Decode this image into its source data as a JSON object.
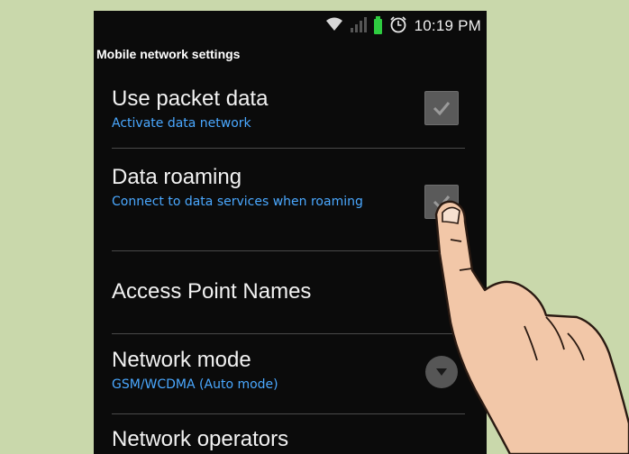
{
  "status_bar": {
    "time": "10:19 PM",
    "icons": [
      "wifi-icon",
      "signal-icon",
      "battery-icon",
      "alarm-icon"
    ]
  },
  "screen": {
    "title": "Mobile network settings",
    "items": [
      {
        "title": "Use packet data",
        "subtitle": "Activate data network",
        "control": "checkbox",
        "checked": true
      },
      {
        "title": "Data roaming",
        "subtitle": "Connect to data services when roaming",
        "control": "checkbox",
        "checked": true
      },
      {
        "title": "Access Point Names"
      },
      {
        "title": "Network mode",
        "subtitle": "GSM/WCDMA (Auto mode)",
        "control": "dropdown"
      },
      {
        "title": "Network operators"
      }
    ]
  },
  "colors": {
    "background": "#c9d8ab",
    "screen": "#0b0b0b",
    "subtitle": "#4aa8ff",
    "battery": "#2ecc40"
  },
  "illustration": "hand-tapping-checkbox"
}
